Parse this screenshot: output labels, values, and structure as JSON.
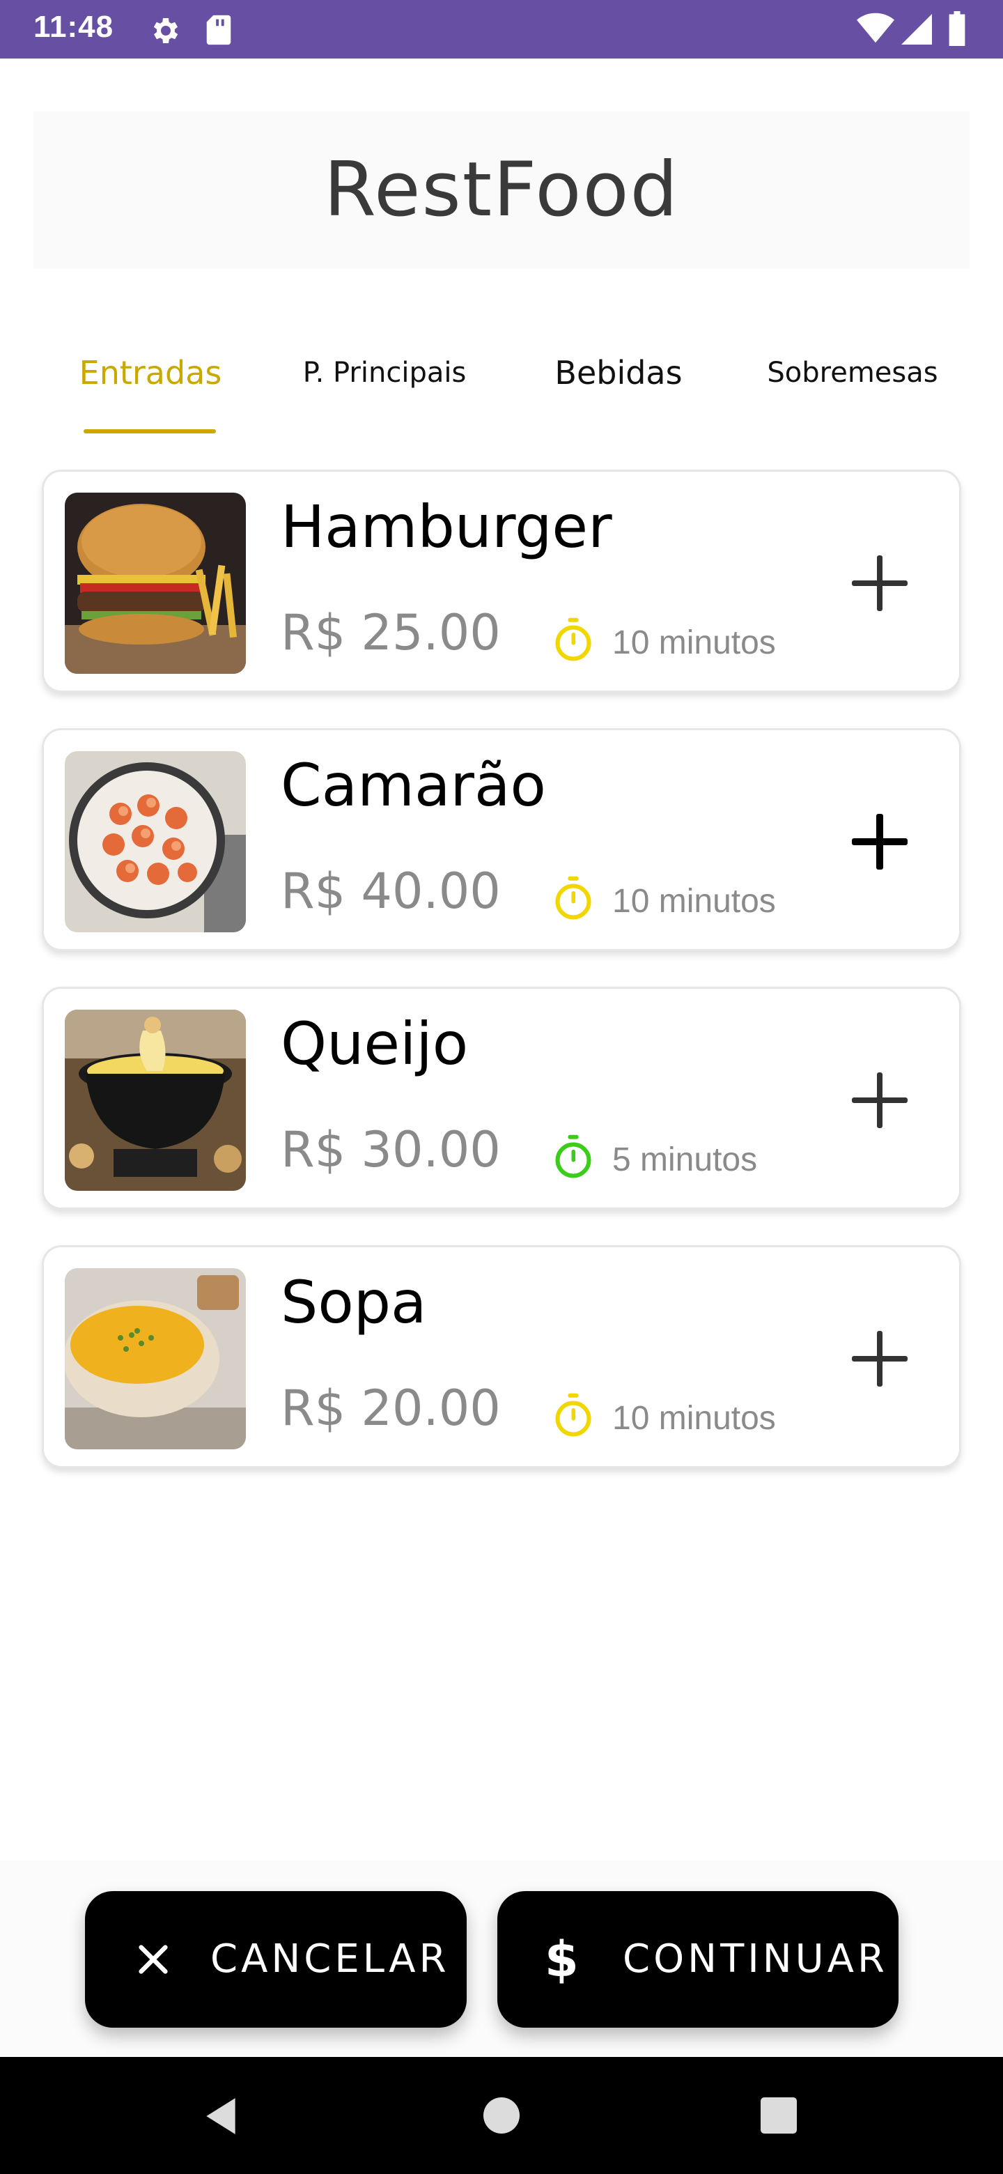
{
  "status_bar": {
    "time": "11:48",
    "icons": [
      "gear-icon",
      "sd-card-icon",
      "wifi-icon",
      "signal-icon",
      "battery-icon"
    ]
  },
  "app": {
    "title": "RestFood"
  },
  "tabs": [
    {
      "label": "Entradas",
      "active": true
    },
    {
      "label": "P. Principais",
      "active": false
    },
    {
      "label": "Bebidas",
      "active": false
    },
    {
      "label": "Sobremesas",
      "active": false
    }
  ],
  "colors": {
    "status_bar": "#6750a4",
    "accent": "#c9a800",
    "timer_yellow": "#f2d600",
    "timer_green": "#3ccc1a"
  },
  "menu_items": [
    {
      "name": "Hamburger",
      "price": "R$ 25.00",
      "time": "10 minutos",
      "timer_color": "yellow",
      "image": "hamburger-photo"
    },
    {
      "name": "Camarão",
      "price": "R$ 40.00",
      "time": "10 minutos",
      "timer_color": "yellow",
      "image": "shrimp-photo"
    },
    {
      "name": "Queijo",
      "price": "R$ 30.00",
      "time": "5 minutos",
      "timer_color": "green",
      "image": "cheese-fondue-photo"
    },
    {
      "name": "Sopa",
      "price": "R$ 20.00",
      "time": "10 minutos",
      "timer_color": "yellow",
      "image": "soup-photo"
    }
  ],
  "actions": {
    "cancel_label": "CANCELAR",
    "cancel_icon": "close-icon",
    "continue_label": "CONTINUAR",
    "continue_icon": "dollar-icon"
  },
  "nav_bar": {
    "icons": [
      "back-icon",
      "home-icon",
      "recents-icon"
    ]
  }
}
